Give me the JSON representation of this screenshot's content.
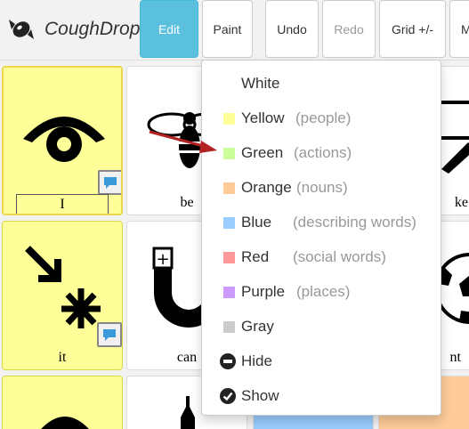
{
  "app": {
    "name": "CoughDrop"
  },
  "toolbar": {
    "edit": "Edit",
    "paint": "Paint",
    "undo": "Undo",
    "redo": "Redo",
    "grid": "Grid +/-",
    "more": "M"
  },
  "board": {
    "cells": [
      {
        "label": "I",
        "color": "#ffff99"
      },
      {
        "label": "be",
        "color": "#ffffff"
      },
      {
        "label": "ke",
        "color": "#ffffff"
      },
      {
        "label": "it",
        "color": "#ffff99"
      },
      {
        "label": "can",
        "color": "#ffffff"
      },
      {
        "label": "nt",
        "color": "#ffffff"
      }
    ]
  },
  "paint_menu": {
    "items": [
      {
        "label": "White",
        "desc": "",
        "color": "#ffffff"
      },
      {
        "label": "Yellow",
        "desc": "(people)",
        "color": "#ffff99"
      },
      {
        "label": "Green",
        "desc": "(actions)",
        "color": "#ccff99"
      },
      {
        "label": "Orange",
        "desc": "(nouns)",
        "color": "#ffcc99"
      },
      {
        "label": "Blue",
        "desc": "(describing words)",
        "color": "#99ccff"
      },
      {
        "label": "Red",
        "desc": "(social words)",
        "color": "#ff9999"
      },
      {
        "label": "Purple",
        "desc": "(places)",
        "color": "#cc99ff"
      },
      {
        "label": "Gray",
        "desc": "",
        "color": "#cccccc"
      }
    ],
    "hide": "Hide",
    "show": "Show"
  },
  "annotation": {
    "arrow_color": "#b22222"
  }
}
